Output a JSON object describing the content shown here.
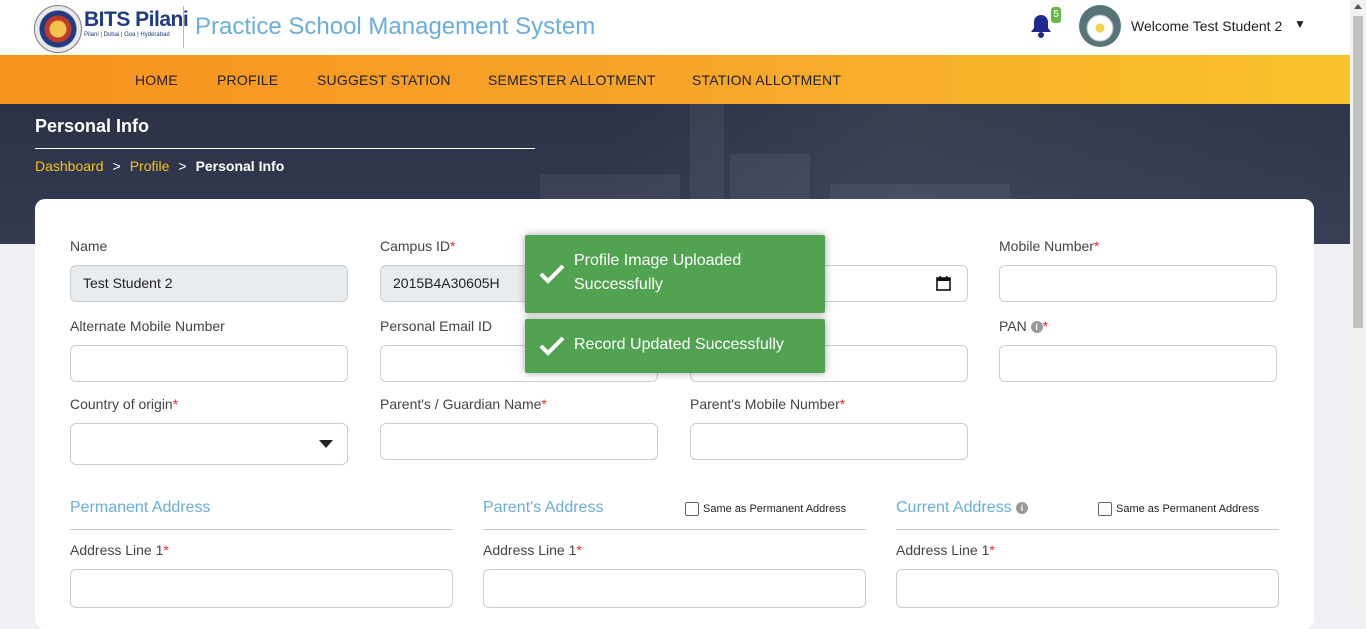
{
  "header": {
    "logo_title": "BITS Pilani",
    "logo_subtitle": "Pilani | Dubai | Goa | Hyderabad",
    "app_title": "Practice School Management System",
    "notification_count": "5",
    "welcome_text": "Welcome Test Student 2",
    "caret": "▼"
  },
  "nav": {
    "items": [
      {
        "label": "HOME"
      },
      {
        "label": "PROFILE"
      },
      {
        "label": "SUGGEST STATION"
      },
      {
        "label": "SEMESTER ALLOTMENT"
      },
      {
        "label": "STATION ALLOTMENT"
      }
    ]
  },
  "banner": {
    "title": "Personal Info",
    "breadcrumb": {
      "items": [
        "Dashboard",
        "Profile"
      ],
      "separator": ">",
      "current": "Personal Info"
    }
  },
  "form": {
    "name": {
      "label": "Name",
      "value": "Test Student 2"
    },
    "campus_id": {
      "label": "Campus ID",
      "value": "2015B4A30605H"
    },
    "mobile": {
      "label": "Mobile Number",
      "value": ""
    },
    "alt_mobile": {
      "label": "Alternate Mobile Number",
      "value": ""
    },
    "personal_email": {
      "label": "Personal Email ID",
      "value": ""
    },
    "pan": {
      "label": "PAN",
      "value": ""
    },
    "country": {
      "label": "Country of origin",
      "value": ""
    },
    "guardian_name": {
      "label": "Parent's / Guardian Name",
      "value": ""
    },
    "parent_mobile": {
      "label": "Parent's Mobile Number",
      "value": ""
    },
    "required_mark": "*",
    "info_glyph": "i"
  },
  "addresses": {
    "permanent": {
      "title": "Permanent Address",
      "line1_label": "Address Line 1"
    },
    "parents": {
      "title": "Parent's Address",
      "same_label": "Same as Permanent Address",
      "line1_label": "Address Line 1"
    },
    "current": {
      "title": "Current Address",
      "same_label": "Same as Permanent Address",
      "line1_label": "Address Line 1"
    }
  },
  "toasts": [
    {
      "message": "Profile Image Uploaded Successfully"
    },
    {
      "message": "Record Updated Successfully"
    }
  ],
  "colors": {
    "nav_gradient_start": "#f7921e",
    "nav_gradient_end": "#f9c32a",
    "link_blue": "#6aaedb",
    "breadcrumb_yellow": "#f5c518",
    "toast_green": "#51a351",
    "required_red": "#e02b2b"
  }
}
